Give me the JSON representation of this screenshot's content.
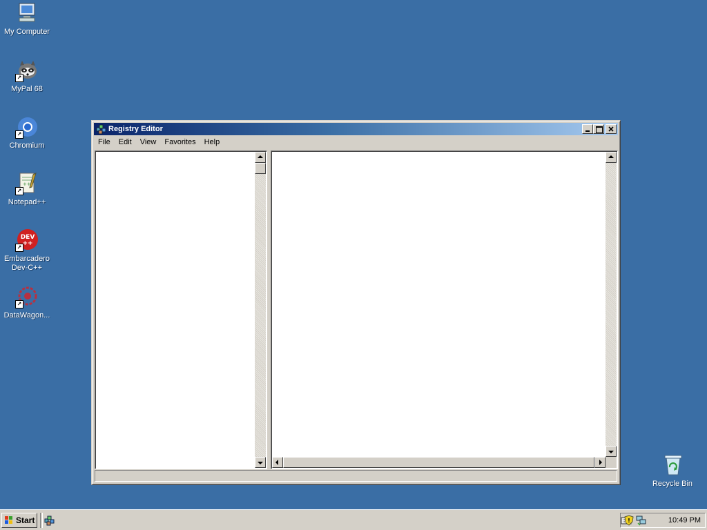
{
  "desktop": {
    "background": "#3a6ea5",
    "icons": [
      {
        "label": "My Computer",
        "icon": "computer-icon"
      },
      {
        "label": "MyPal 68",
        "icon": "raccoon-icon"
      },
      {
        "label": "Chromium",
        "icon": "chromium-icon"
      },
      {
        "label": "Notepad++",
        "icon": "notepad-plus-plus-icon"
      },
      {
        "label": "Embarcadero\nDev-C++",
        "icon": "dev-cpp-icon",
        "badge": "DEV\n++"
      },
      {
        "label": "DataWagon...",
        "icon": "datawagon-icon"
      },
      {
        "label": "Recycle Bin",
        "icon": "recycle-bin-icon"
      }
    ]
  },
  "window": {
    "title": "Registry Editor",
    "icon": "regedit-icon",
    "controls": {
      "minimize": "minimize-icon",
      "maximize": "maximize-icon",
      "close": "close-icon"
    },
    "menu": [
      "File",
      "Edit",
      "View",
      "Favorites",
      "Help"
    ],
    "status_text": ""
  },
  "taskbar": {
    "start_label": "Start",
    "quick_launch": [
      "regedit-icon"
    ],
    "tray_icons": [
      "keyboard-icon",
      "security-shield-icon",
      "network-icon"
    ],
    "clock": "10:49 PM"
  },
  "colors": {
    "title_start": "#0a246a",
    "title_end": "#a6caf0",
    "face": "#d4d0c8"
  }
}
